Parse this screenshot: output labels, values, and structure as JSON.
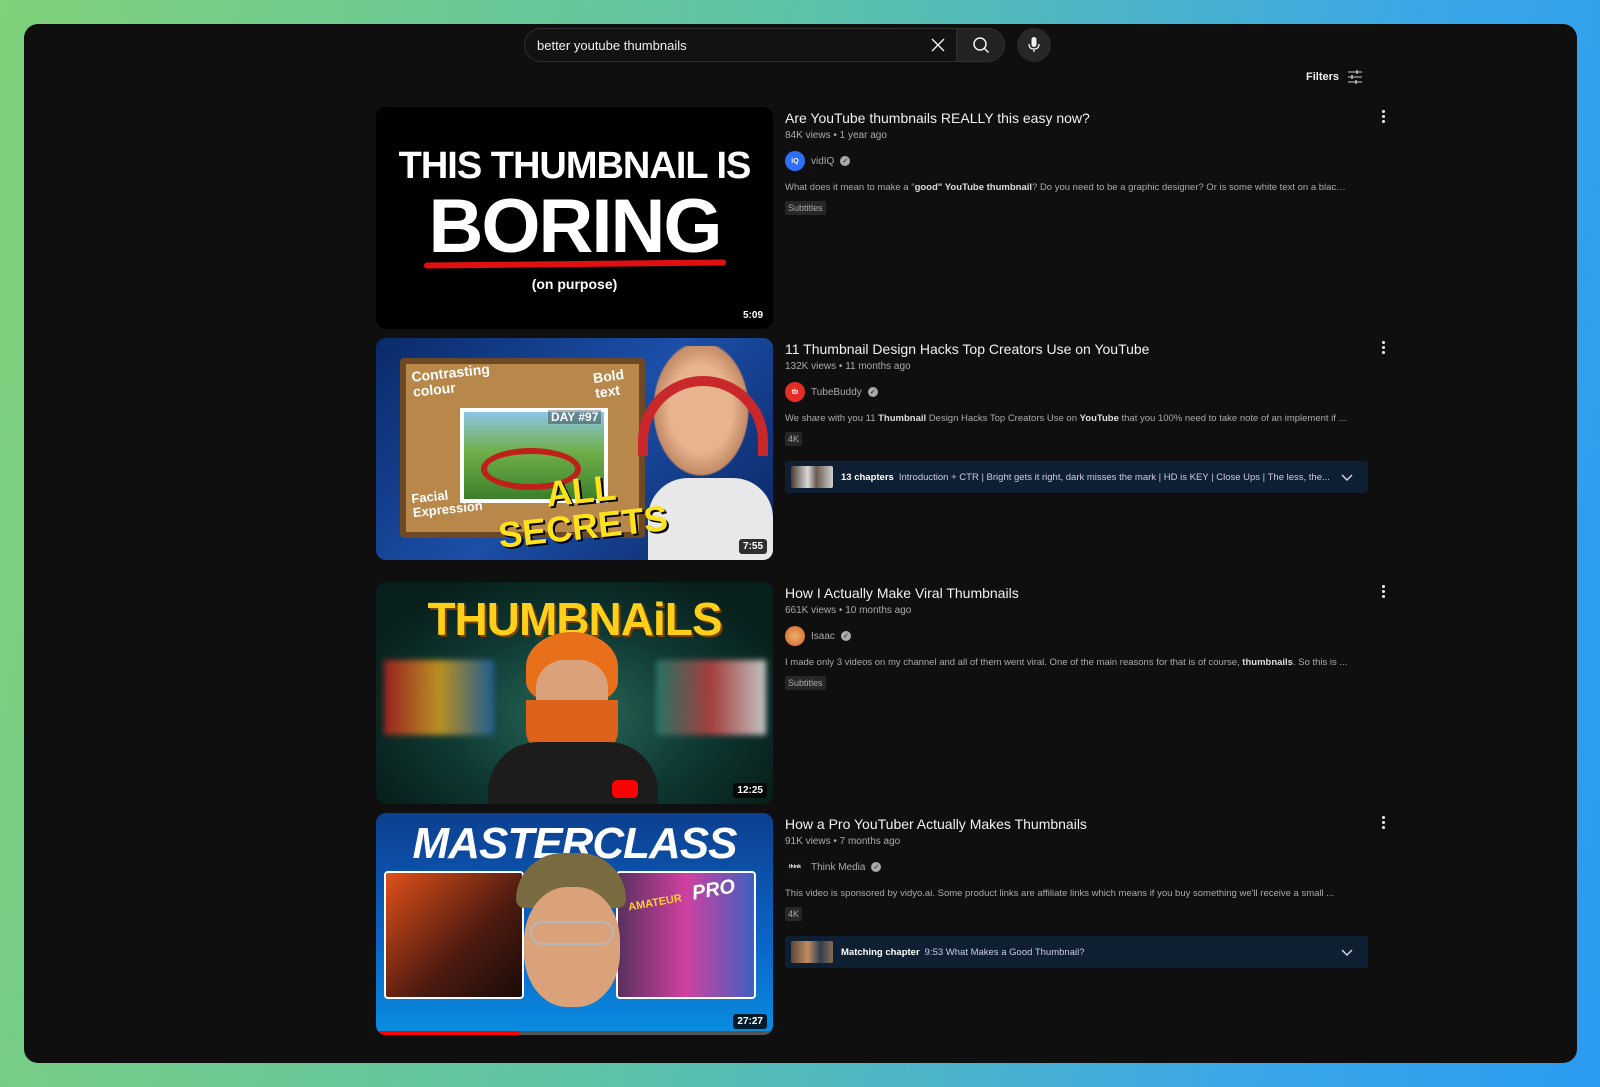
{
  "search": {
    "query": "better youtube thumbnails"
  },
  "filters_label": "Filters",
  "results": [
    {
      "title": "Are YouTube thumbnails REALLY this easy now?",
      "meta": "84K views • 1 year ago",
      "channel": "vidIQ",
      "avatar_text": "iQ",
      "desc_pre": "What does it mean to make a \"",
      "desc_bold1": "good\" YouTube thumbnail",
      "desc_post": "? Do you need to be a graphic designer? Or is some white text on a black ...",
      "badge": "Subtitles",
      "duration": "5:09",
      "thumb_line1": "THIS THUMBNAIL IS",
      "thumb_line2": "BORING",
      "thumb_line3": "(on purpose)"
    },
    {
      "title": "11 Thumbnail Design Hacks Top Creators Use on YouTube",
      "meta": "132K views • 11 months ago",
      "channel": "TubeBuddy",
      "avatar_text": "tb",
      "desc_pre": "We share with you 11 ",
      "desc_bold1": "Thumbnail",
      "desc_mid": " Design Hacks Top Creators Use on ",
      "desc_bold2": "YouTube",
      "desc_post": " that you 100% need to take note of an implement if ...",
      "badge": "4K",
      "duration": "7:55",
      "chapters_label": "13 chapters",
      "chapters_text": "Introduction + CTR | Bright gets it right, dark misses the mark | HD is KEY | Close Ups | The less, the...",
      "thumb_text1": "Contrasting colour",
      "thumb_text2": "Bold text",
      "thumb_text3": "DAY #97",
      "thumb_text4": "Facial Expression",
      "thumb_text5": "ALL",
      "thumb_text6": "SECRETS"
    },
    {
      "title": "How I Actually Make Viral Thumbnails",
      "meta": "661K views • 10 months ago",
      "channel": "Isaac",
      "avatar_text": "",
      "desc_pre": "I made only 3 videos on my channel and all of them went viral. One of the main reasons for that is of course, ",
      "desc_bold1": "thumbnails",
      "desc_post": ". So this is ...",
      "badge": "Subtitles",
      "duration": "12:25",
      "thumb_text1": "THUMBNAiLS"
    },
    {
      "title": "How a Pro YouTuber Actually Makes Thumbnails",
      "meta": "91K views • 7 months ago",
      "channel": "Think Media",
      "avatar_text": "think",
      "desc_pre": "This video is sponsored by vidyo.ai. Some product links are affiliate links which means if you buy something we'll receive a small ...",
      "badge": "4K",
      "duration": "27:27",
      "chapters_label": "Matching chapter",
      "chapters_text": "9:53 What Makes a Good Thumbnail?",
      "thumb_text1": "MASTERCLASS",
      "thumb_text2": "AMATEUR",
      "thumb_text3": "PRO"
    }
  ],
  "colors": {
    "bg": "#0f0f0f",
    "chapter_bg": "#0e1f33",
    "accent_red": "#ff0000"
  }
}
